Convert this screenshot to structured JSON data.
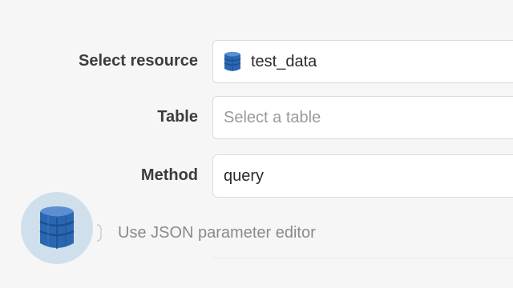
{
  "form": {
    "resource": {
      "label": "Select resource",
      "value": "test_data",
      "icon": "dynamodb-icon"
    },
    "table": {
      "label": "Table",
      "placeholder": "Select a table"
    },
    "method": {
      "label": "Method",
      "value": "query"
    },
    "json_editor": {
      "label": "Use JSON parameter editor"
    }
  },
  "colors": {
    "background": "#f6f6f6",
    "field_border": "#dcdcdc",
    "avatar_bg": "#cfe0ec",
    "db_icon_blue": "#2b67b1"
  }
}
